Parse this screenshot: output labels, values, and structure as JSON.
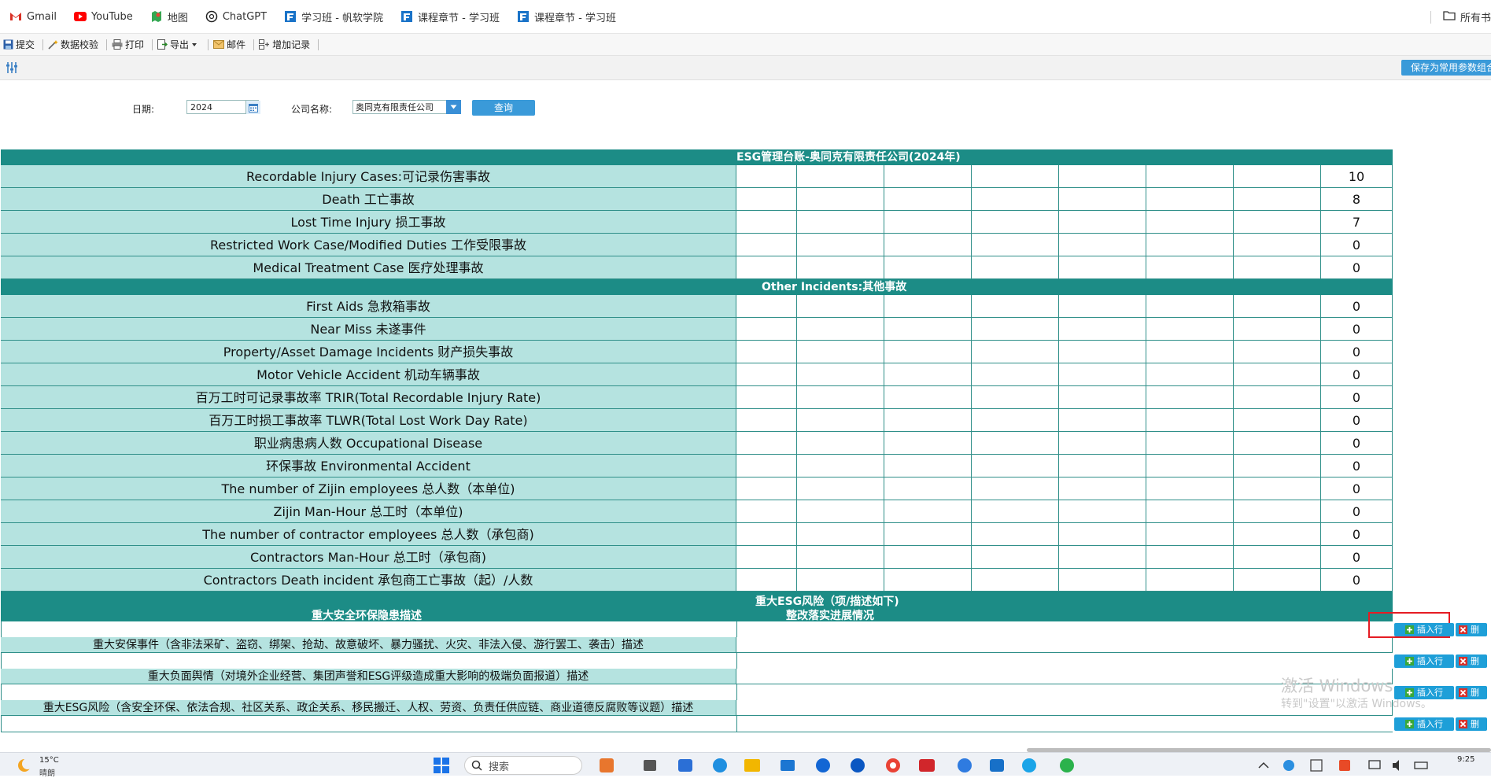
{
  "bookmarks": {
    "items": [
      {
        "label": "Gmail"
      },
      {
        "label": "YouTube"
      },
      {
        "label": "地图"
      },
      {
        "label": "ChatGPT"
      },
      {
        "label": "学习班 - 帆软学院"
      },
      {
        "label": "课程章节 - 学习班"
      },
      {
        "label": "课程章节 - 学习班"
      }
    ],
    "all_bookmarks": "所有书"
  },
  "toolbar": {
    "submit": "提交",
    "validate": "数据校验",
    "print": "打印",
    "export": "导出",
    "mail": "邮件",
    "add_record": "增加记录"
  },
  "strip": {
    "save_params": "保存为常用参数组合"
  },
  "form": {
    "date_label": "日期:",
    "date_value": "2024",
    "company_label": "公司名称:",
    "company_value": "奥同克有限责任公司",
    "query_button": "查询"
  },
  "table": {
    "title": "ESG管理台账-奥同克有限责任公司(2024年)",
    "section1": [
      {
        "label": "Recordable Injury Cases:可记录伤害事故",
        "value": "10"
      },
      {
        "label": "Death 工亡事故",
        "value": "8"
      },
      {
        "label": "Lost Time Injury 损工事故",
        "value": "7"
      },
      {
        "label": "Restricted Work Case/Modified Duties 工作受限事故",
        "value": "0"
      },
      {
        "label": "Medical Treatment Case 医疗处理事故",
        "value": "0"
      }
    ],
    "other_header": "Other Incidents:其他事故",
    "section2": [
      {
        "label": "First Aids 急救箱事故",
        "value": "0"
      },
      {
        "label": "Near Miss 未遂事件",
        "value": "0"
      },
      {
        "label": "Property/Asset Damage Incidents 财产损失事故",
        "value": "0"
      },
      {
        "label": "Motor Vehicle Accident 机动车辆事故",
        "value": "0"
      },
      {
        "label": "百万工时可记录事故率 TRIR(Total Recordable Injury Rate)",
        "value": "0"
      },
      {
        "label": "百万工时损工事故率 TLWR(Total Lost Work Day Rate)",
        "value": "0"
      },
      {
        "label": "职业病患病人数 Occupational Disease",
        "value": "0"
      },
      {
        "label": "环保事故 Environmental Accident",
        "value": "0"
      },
      {
        "label": "The number of Zijin employees 总人数（本单位)",
        "value": "0"
      },
      {
        "label": "Zijin Man-Hour 总工时（本单位)",
        "value": "0"
      },
      {
        "label": "The number of contractor employees 总人数（承包商)",
        "value": "0"
      },
      {
        "label": "Contractors Man-Hour 总工时（承包商)",
        "value": "0"
      },
      {
        "label": "Contractors Death incident 承包商工亡事故（起）/人数",
        "value": "0"
      }
    ],
    "risk_header": "重大ESG风险（项/描述如下)",
    "desc_header_left": "重大安全环保隐患描述",
    "desc_header_right": "整改落实进展情况",
    "descriptions": [
      "重大安保事件（含非法采矿、盗窃、绑架、抢劫、故意破坏、暴力骚扰、火灾、非法入侵、游行罢工、袭击）描述",
      "重大负面舆情（对境外企业经营、集团声誉和ESG评级造成重大影响的极端负面报道）描述",
      "重大ESG风险（含安全环保、依法合规、社区关系、政企关系、移民搬迁、人权、劳资、负责任供应链、商业道德反腐败等议题）描述"
    ],
    "insert_label": "插入行",
    "delete_label": "删"
  },
  "watermark": {
    "line1": "激活 Windows",
    "line2": "转到\"设置\"以激活 Windows。"
  },
  "taskbar": {
    "temperature": "15°C",
    "weather": "晴朗",
    "search": "搜索",
    "time": "9:25"
  },
  "colors": {
    "header_teal": "#1c8c86",
    "label_cell": "#b5e3e0",
    "button_blue": "#3a9ad9",
    "highlight_red": "#e51c23"
  }
}
